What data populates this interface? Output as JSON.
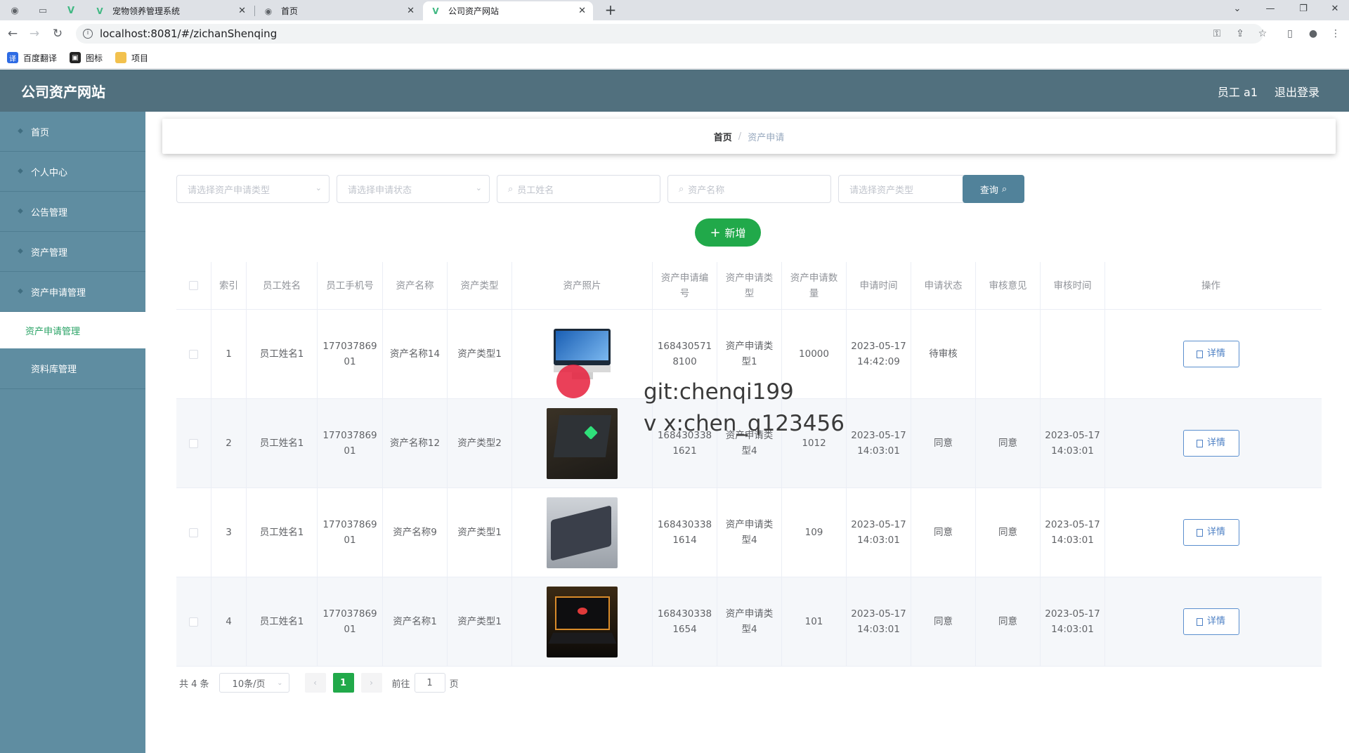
{
  "browser": {
    "tabs": [
      {
        "title": "宠物领养管理系统",
        "active": false
      },
      {
        "title": "首页",
        "active": false
      },
      {
        "title": "公司资产网站",
        "active": true
      }
    ],
    "url": "localhost:8081/#/zichanShenqing",
    "bookmarks": [
      "百度翻译",
      "图标",
      "项目"
    ]
  },
  "header": {
    "brand": "公司资产网站",
    "user": "员工 a1",
    "logout": "退出登录"
  },
  "sidebar": {
    "items": [
      {
        "label": "首页"
      },
      {
        "label": "个人中心"
      },
      {
        "label": "公告管理"
      },
      {
        "label": "资产管理"
      },
      {
        "label": "资产申请管理"
      }
    ],
    "submenu_active": "资产申请管理",
    "extra": "资料库管理"
  },
  "breadcrumb": {
    "home": "首页",
    "current": "资产申请"
  },
  "filters": {
    "apply_type_placeholder": "请选择资产申请类型",
    "status_placeholder": "请选择申请状态",
    "employee_placeholder": "员工姓名",
    "asset_name_placeholder": "资产名称",
    "asset_type_placeholder": "请选择资产类型",
    "query_label": "查询"
  },
  "add_label": "新增",
  "table": {
    "headers": [
      "索引",
      "员工姓名",
      "员工手机号",
      "资产名称",
      "资产类型",
      "资产照片",
      "资产申请编号",
      "资产申请类型",
      "资产申请数量",
      "申请时间",
      "申请状态",
      "审核意见",
      "审核时间",
      "操作"
    ],
    "rows": [
      {
        "index": "1",
        "name": "员工姓名1",
        "phone": "17703786901",
        "asset": "资产名称14",
        "type": "资产类型1",
        "photo": "monitor",
        "code": "1684305718100",
        "apply_type": "资产申请类型1",
        "qty": "10000",
        "time": "2023-05-17 14:42:09",
        "status": "待审核",
        "opinion": "",
        "audit_time": ""
      },
      {
        "index": "2",
        "name": "员工姓名1",
        "phone": "17703786901",
        "asset": "资产名称12",
        "type": "资产类型2",
        "photo": "laptop-green",
        "code": "1684303381621",
        "apply_type": "资产申请类型4",
        "qty": "1012",
        "time": "2023-05-17 14:03:01",
        "status": "同意",
        "opinion": "同意",
        "audit_time": "2023-05-17 14:03:01"
      },
      {
        "index": "3",
        "name": "员工姓名1",
        "phone": "17703786901",
        "asset": "资产名称9",
        "type": "资产类型1",
        "photo": "laptop-dark",
        "code": "1684303381614",
        "apply_type": "资产申请类型4",
        "qty": "109",
        "time": "2023-05-17 14:03:01",
        "status": "同意",
        "opinion": "同意",
        "audit_time": "2023-05-17 14:03:01"
      },
      {
        "index": "4",
        "name": "员工姓名1",
        "phone": "17703786901",
        "asset": "资产名称1",
        "type": "资产类型1",
        "photo": "laptop-red",
        "code": "1684303381654",
        "apply_type": "资产申请类型4",
        "qty": "101",
        "time": "2023-05-17 14:03:01",
        "status": "同意",
        "opinion": "同意",
        "audit_time": "2023-05-17 14:03:01"
      }
    ],
    "action_label": "详情"
  },
  "pagination": {
    "total": "共 4 条",
    "page_size": "10条/页",
    "current": "1",
    "goto_prefix": "前往",
    "goto_value": "1",
    "goto_suffix": "页"
  },
  "watermark": {
    "line1": "git:chenqi199",
    "line2": "v x:chen_q123456"
  },
  "colors": {
    "header": "#51707e",
    "sidebar": "#5f8da1",
    "accent": "#21a94a",
    "query": "#51829a"
  }
}
